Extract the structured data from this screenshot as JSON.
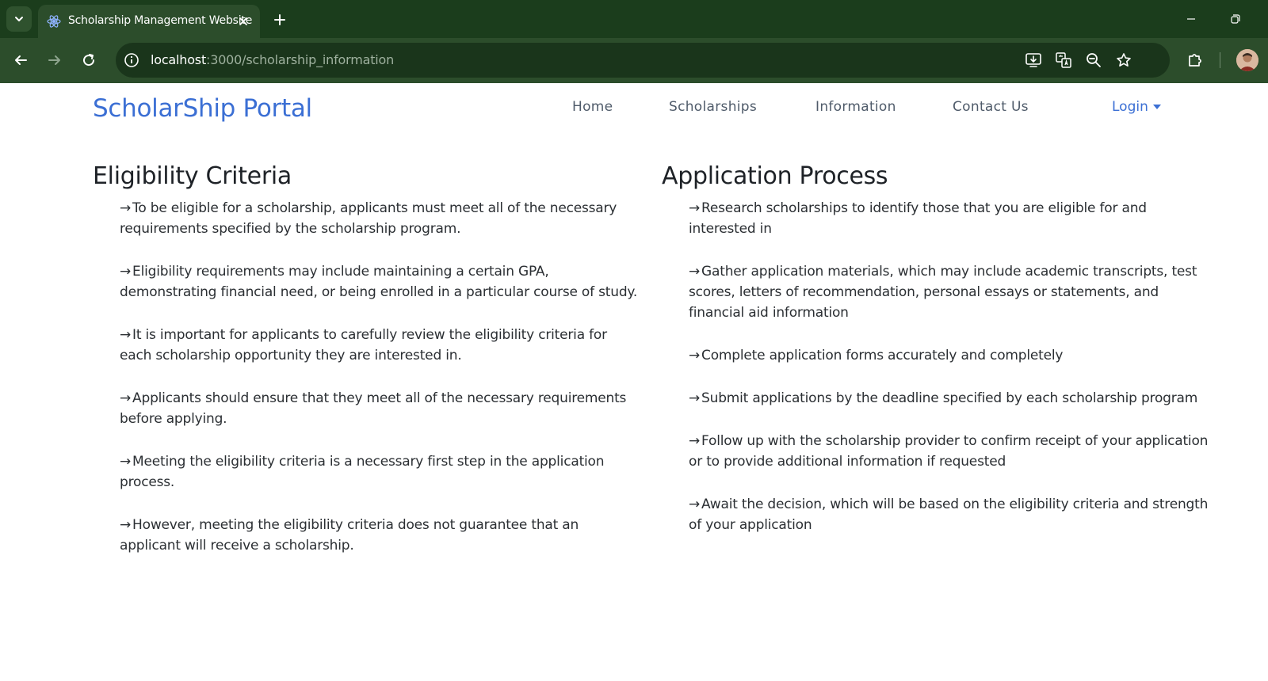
{
  "browser": {
    "tab_title": "Scholarship Management Website",
    "url_host": "localhost",
    "url_path": ":3000/scholarship_information"
  },
  "navbar": {
    "brand": "ScholarShip Portal",
    "links": [
      "Home",
      "Scholarships",
      "Information",
      "Contact Us"
    ],
    "login_label": "Login"
  },
  "eligibility": {
    "title": "Eligibility Criteria",
    "items": [
      "To be eligible for a scholarship, applicants must meet all of the necessary requirements specified by the scholarship program.",
      "Eligibility requirements may include maintaining a certain GPA, demonstrating financial need, or being enrolled in a particular course of study.",
      "It is important for applicants to carefully review the eligibility criteria for each scholarship opportunity they are interested in.",
      "Applicants should ensure that they meet all of the necessary requirements before applying.",
      "Meeting the eligibility criteria is a necessary first step in the application process.",
      "However, meeting the eligibility criteria does not guarantee that an applicant will receive a scholarship."
    ]
  },
  "application": {
    "title": "Application Process",
    "items": [
      "Research scholarships to identify those that you are eligible for and interested in",
      "Gather application materials, which may include academic transcripts, test scores, letters of recommendation, personal essays or statements, and financial aid information",
      "Complete application forms accurately and completely",
      "Submit applications by the deadline specified by each scholarship program",
      "Follow up with the scholarship provider to confirm receipt of your application or to provide additional information if requested",
      "Await the decision, which will be based on the eligibility criteria and strength of your application"
    ]
  },
  "icons": {
    "bullet": "arrow-right-icon",
    "brand_color": "#3b6fd4",
    "chrome_color": "#2c4d2b"
  }
}
